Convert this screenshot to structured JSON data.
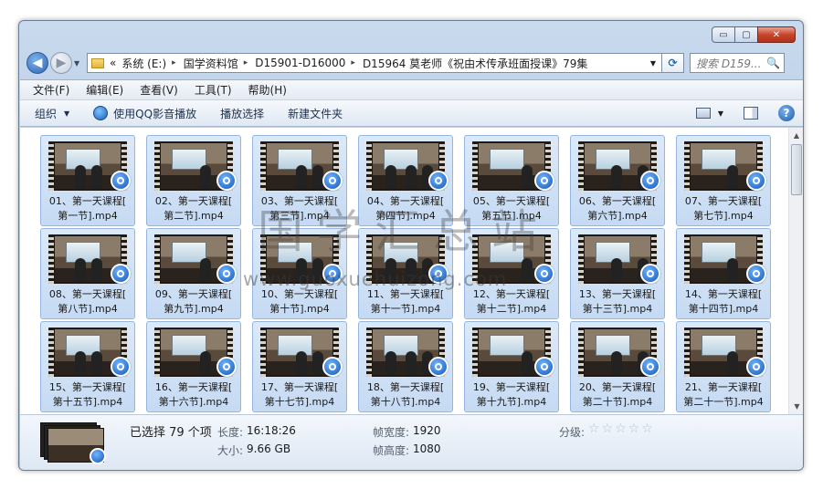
{
  "window": {
    "min": "▭",
    "max": "▢",
    "close": "✕"
  },
  "address": {
    "lead": "«",
    "crumbs": [
      "系统 (E:)",
      "国学资料馆",
      "D15901-D16000",
      "D15964 莫老师《祝由术传承班面授课》79集"
    ],
    "sep": "▸",
    "drop": "▼"
  },
  "search": {
    "placeholder": "搜索 D159...",
    "icon": "🔍"
  },
  "menu": [
    "文件(F)",
    "编辑(E)",
    "查看(V)",
    "工具(T)",
    "帮助(H)"
  ],
  "toolbar": {
    "organize": "组织",
    "play_qq": "使用QQ影音播放",
    "play_select": "播放选择",
    "new_folder": "新建文件夹",
    "help": "?"
  },
  "files": [
    [
      "01、第一天课程[",
      "第一节].mp4"
    ],
    [
      "02、第一天课程[",
      "第二节].mp4"
    ],
    [
      "03、第一天课程[",
      "第三节].mp4"
    ],
    [
      "04、第一天课程[",
      "第四节].mp4"
    ],
    [
      "05、第一天课程[",
      "第五节].mp4"
    ],
    [
      "06、第一天课程[",
      "第六节].mp4"
    ],
    [
      "07、第一天课程[",
      "第七节].mp4"
    ],
    [
      "08、第一天课程[",
      "第八节].mp4"
    ],
    [
      "09、第一天课程[",
      "第九节].mp4"
    ],
    [
      "10、第一天课程[",
      "第十节].mp4"
    ],
    [
      "11、第一天课程[",
      "第十一节].mp4"
    ],
    [
      "12、第一天课程[",
      "第十二节].mp4"
    ],
    [
      "13、第一天课程[",
      "第十三节].mp4"
    ],
    [
      "14、第一天课程[",
      "第十四节].mp4"
    ],
    [
      "15、第一天课程[",
      "第十五节].mp4"
    ],
    [
      "16、第一天课程[",
      "第十六节].mp4"
    ],
    [
      "17、第一天课程[",
      "第十七节].mp4"
    ],
    [
      "18、第一天课程[",
      "第十八节].mp4"
    ],
    [
      "19、第一天课程[",
      "第十九节].mp4"
    ],
    [
      "20、第一天课程[",
      "第二十节].mp4"
    ],
    [
      "21、第一天课程[",
      "第二十一节].mp4"
    ]
  ],
  "details": {
    "selected": "已选择 79 个项",
    "length_label": "长度:",
    "length": "16:18:26",
    "size_label": "大小:",
    "size": "9.66 GB",
    "width_label": "帧宽度:",
    "width": "1920",
    "height_label": "帧高度:",
    "height": "1080",
    "rating_label": "分级:",
    "rating": 0
  },
  "watermark": {
    "big": "国学汇总站",
    "small": "www.guoxuehuizong.com"
  }
}
